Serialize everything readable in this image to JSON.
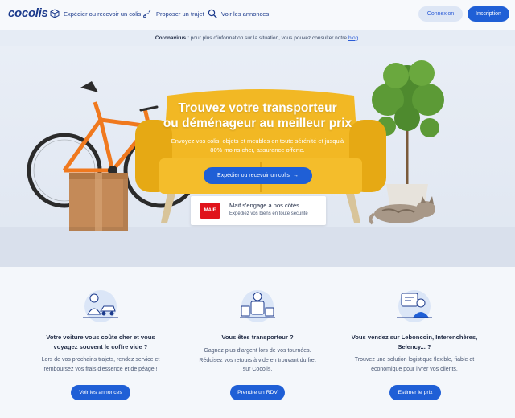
{
  "header": {
    "logo": "cocolis",
    "nav": [
      {
        "label": "Expédier ou recevoir un colis",
        "icon": "package-icon"
      },
      {
        "label": "Proposer un trajet",
        "icon": "route-icon"
      },
      {
        "label": "Voir les annonces",
        "icon": "search-icon"
      }
    ],
    "login_label": "Connexion",
    "signup_label": "Inscription"
  },
  "banner": {
    "bold": "Coronavirus",
    "text": ": pour plus d'information sur la situation, vous pouvez consulter notre",
    "link": "blog",
    "end": "."
  },
  "hero": {
    "title_line1": "Trouvez votre transporteur",
    "title_line2": "ou déménageur au meilleur prix",
    "sub_line1": "Envoyez vos colis, objets et meubles en toute sérénité et jusqu'à",
    "sub_line2": "80% moins cher, assurance offerte.",
    "cta_label": "Expédier ou recevoir un colis",
    "cta_arrow": "→",
    "maif": {
      "logo_text": "MAIF",
      "title": "Maif s'engage à nos côtés",
      "subtitle": "Expédiez vos biens en toute sécurité"
    }
  },
  "features": [
    {
      "icon": "car-driver-icon",
      "title_line1": "Votre voiture vous coûte cher et vous",
      "title_line2": "voyagez souvent le coffre vide ?",
      "text_line1": "Lors de vos prochains trajets, rendez service et",
      "text_line2": "remboursez vos frais d'essence et de péage !",
      "text_line3": "",
      "button": "Voir les annonces"
    },
    {
      "icon": "mover-icon",
      "title_line1": "Vous êtes transporteur ?",
      "title_line2": "",
      "text_line1": "Gagnez plus d'argent lors de vos tournées.",
      "text_line2": "Réduisez vos retours à vide en trouvant du fret",
      "text_line3": "sur Cocolis.",
      "button": "Prendre un RDV"
    },
    {
      "icon": "seller-icon",
      "title_line1": "Vous vendez sur Leboncoin, Interenchères,",
      "title_line2": "Selency... ?",
      "text_line1": "Trouvez une solution logistique flexible, fiable et",
      "text_line2": "économique pour livrer vos clients.",
      "text_line3": "",
      "button": "Estimer le prix"
    }
  ],
  "colors": {
    "brand": "#1b3a8c",
    "primary_button": "#1f5fd6",
    "sofa": "#f2b824",
    "bike": "#f0791e",
    "maif_red": "#e0131b"
  }
}
